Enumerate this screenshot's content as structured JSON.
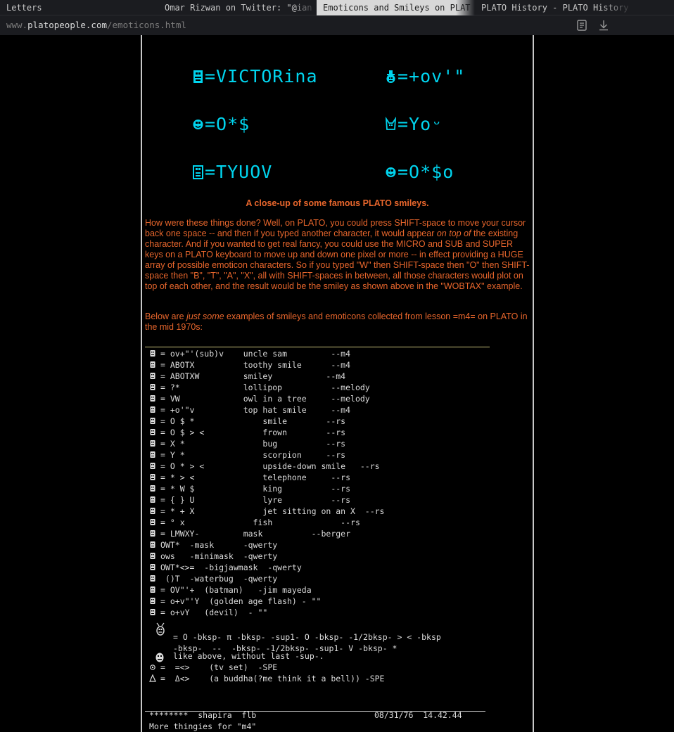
{
  "browser": {
    "tabs": [
      {
        "title": "Letters"
      },
      {
        "title": "Omar Rizwan on Twitter: \"@ian"
      },
      {
        "title": "Emoticons and Smileys on PLAT"
      },
      {
        "title": "PLATO History - PLATO History"
      }
    ],
    "active_tab": 2,
    "url": {
      "prefix": "www.",
      "host": "platopeople.com",
      "path": "/emoticons.html"
    },
    "reader_icon": "reader-view-icon",
    "download_icon": "download-icon"
  },
  "closeup_smileys": [
    {
      "text": "=VICTORina",
      "icon": "plato-smiley-glyph"
    },
    {
      "text": "=+ov'\"",
      "icon": "plato-smiley-glyph"
    },
    {
      "text": "=O*$",
      "icon": "plato-smiley-glyph"
    },
    {
      "text": "=Yoᵕ",
      "icon": "plato-smiley-glyph"
    },
    {
      "text": "=TYUOV",
      "icon": "plato-smiley-glyph"
    },
    {
      "text": "=O*$o",
      "icon": "plato-smiley-glyph"
    }
  ],
  "caption": "A close-up of some famous PLATO smileys.",
  "paragraph1": {
    "before": "How were these things done? Well, on PLATO, you could press SHIFT-space to move your cursor back one space -- and then if you typed another character, it would appear ",
    "emphasis": "on top of",
    "after": " the existing character. And if you wanted to get real fancy, you could use the MICRO and SUB and SUPER keys on a PLATO keyboard to move up and down one pixel or more -- in effect providing a HUGE array of possible emoticon characters. So if you typed \"W\" then SHIFT-space then \"O\" then SHIFT-space then \"B\", \"T\", \"A\", \"X\", all with SHIFT-spaces in between, all those characters would plot on top of each other, and the result would be the smiley as shown above in the \"WOBTAX\" example."
  },
  "paragraph2": {
    "before": "Below are ",
    "emphasis": "just some",
    "after": " examples of smileys and emoticons collected from lesson =m4= on PLATO in the mid 1970s:"
  },
  "listing": [
    "= ov+\"'(sub)v    uncle sam         --m4",
    "= ABOTX          toothy smile      --m4",
    "= ABOTXW         smiley           --m4",
    "= ?*             lollipop          --melody",
    "= VW             owl in a tree     --melody",
    "= +o'\"v          top hat smile     --m4",
    "= O $ *              smile        --rs",
    "= O $ > <            frown        --rs",
    "= X *                bug          --rs",
    "= Y *                scorpion     --rs",
    "= O * > <            upside-down smile   --rs",
    "= * > <              telephone     --rs",
    "= * W $              king          --rs",
    "= { } U              lyre          --rs",
    "= * + X              jet sitting on an X  --rs",
    "= ° x              fish              --rs",
    "= LMWXY-         mask          --berger",
    "OWT*  -mask      -qwerty",
    "ows   -minimask  -qwerty",
    "OWT*<>=  -bigjawmask  -qwerty",
    " ()T  -waterbug  -qwerty",
    "= OV\"'+  (batman)   -jim mayeda",
    "= o+v\"'Y  (golden age flash) - \"\"",
    "= o+vY   (devil)  - \"\""
  ],
  "listing_extra": {
    "line1": "= O -bksp- π -bksp- -sup1- O -bksp- -1/2bksp- > < -bksp",
    "line2": "-bksp-  --  -bksp- -1/2bksp- -sup1- V -bksp- *",
    "line3": "like above, without last -sup-.",
    "line4": "=  =<>    (tv set)  -SPE",
    "line5": "=  Δ<>    (a buddha(?me think it a bell)) -SPE"
  },
  "footer": {
    "stars": "********",
    "name": "shapira  flb",
    "datetime": "08/31/76  14.42.44",
    "more": "More thingies for \"m4\""
  },
  "colors": {
    "cyan": "#00d4ee",
    "orange": "#e8662c",
    "terminal_text": "#dcdcdc"
  }
}
